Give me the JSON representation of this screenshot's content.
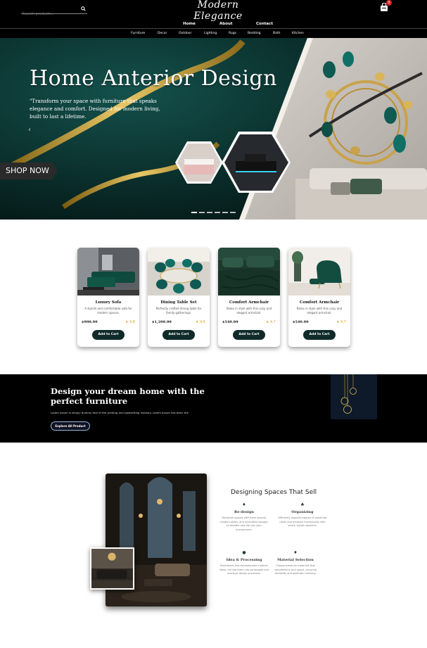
{
  "header": {
    "search_placeholder": "Search products...",
    "logo_text": "Modern Elegance",
    "cart_count": "0",
    "main_nav": [
      "Home",
      "About",
      "Contact"
    ],
    "categories": [
      "Furniture",
      "Decor",
      "Outdoor",
      "Lighting",
      "Rugs",
      "Bedding",
      "Bath",
      "Kitchen"
    ]
  },
  "hero": {
    "title": "Home Anterior Design",
    "text": "\"Transform your space with furniture that speaks elegance and comfort. Designed for modern living, built to last a lifetime.",
    "shop_button": "SHOP NOW",
    "slide_count": 6,
    "active_slide": 1
  },
  "products": [
    {
      "name": "Luxury Sofa",
      "desc": "A stylish and comfortable sofa for modern spaces.",
      "price": "$999.99",
      "rating": "★ 4.8",
      "button": "Add to Cart"
    },
    {
      "name": "Dining Table Set",
      "desc": "Perfectly crafted dining table for family gatherings.",
      "price": "$1,299.99",
      "rating": "★ 4.6",
      "button": "Add to Cart"
    },
    {
      "name": "Comfort Armchair",
      "desc": "Relax in style with this cozy and elegant armchair.",
      "price": "$549.99",
      "rating": "★ 4.7",
      "button": "Add to Cart"
    },
    {
      "name": "Comfort Armchair",
      "desc": "Relax in style with this cozy and elegant armchair.",
      "price": "$549.99",
      "rating": "★ 4.7",
      "button": "Add to Cart"
    }
  ],
  "banner": {
    "heading": "Design your dream home with the perfect furniture",
    "text": "Lorem Ipsum is simply dummy text of the printing and typesetting industry. Lorem Ipsum has been the",
    "button": "Explore All Product"
  },
  "services": {
    "title": "Designing Spaces That Sell",
    "items": [
      {
        "title": "Re-design",
        "desc": "Transform spaces with fresh layouts, modern styles, and innovative designs to breathe new life into your environment."
      },
      {
        "title": "Organizing",
        "desc": "Efficiently organize spaces to maximize utility and enhance functionality with smart, stylish solutions."
      },
      {
        "title": "Idea & Processing",
        "desc": "Brainstorm and conceptualize creative ideas, turning them into achievable and practical design processes."
      },
      {
        "title": "Material Selection",
        "desc": "Choose premium materials that complement your space, ensuring durability and aesthetic harmony."
      }
    ]
  }
}
